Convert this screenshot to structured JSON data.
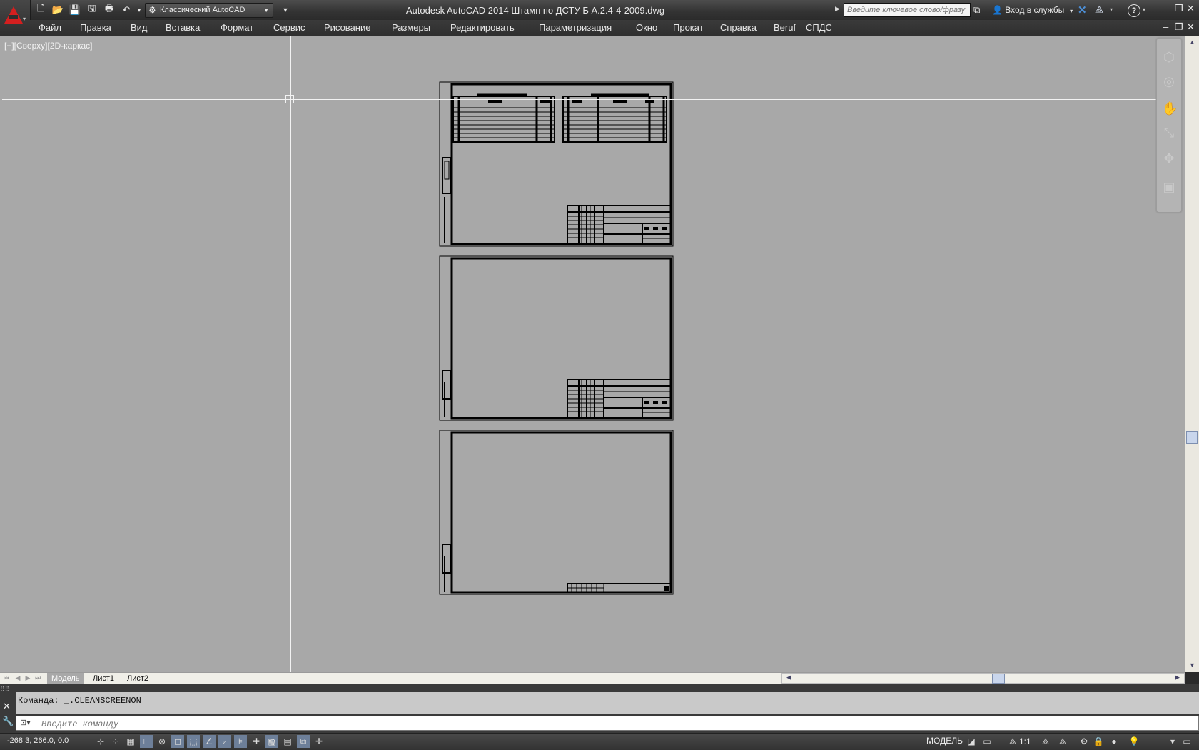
{
  "titlebar": {
    "workspace": "Классический AutoCAD",
    "title": "Autodesk AutoCAD 2014    Штамп по ДСТУ Б А.2.4-4-2009.dwg",
    "search_placeholder": "Введите ключевое слово/фразу",
    "signin": "Вход в службы",
    "help": "?"
  },
  "menu": [
    "Файл",
    "Правка",
    "Вид",
    "Вставка",
    "Формат",
    "Сервис",
    "Рисование",
    "Размеры",
    "Редактировать",
    "Параметризация",
    "Окно",
    "Прокат",
    "Справка",
    "Beruf",
    "СПДС"
  ],
  "viewport": {
    "label": "[−][Сверху][2D-каркас]"
  },
  "tabs": [
    "Модель",
    "Лист1",
    "Лист2"
  ],
  "command": {
    "history": "Команда:  _.CLEANSCREENON",
    "placeholder": "Введите команду"
  },
  "status": {
    "coords": "-268.3, 266.0, 0.0",
    "model": "МОДЕЛЬ",
    "scale": "1:1"
  },
  "colors": {
    "accent": "#d41f1f",
    "drawing_bg": "#a8a8a8"
  }
}
